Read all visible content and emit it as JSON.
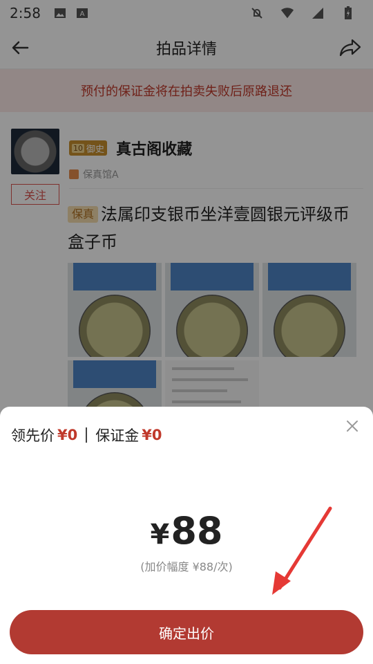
{
  "status_bar": {
    "time": "2:58"
  },
  "nav": {
    "title": "拍品详情"
  },
  "notice": {
    "text": "预付的保证金将在拍卖失败后原路退还"
  },
  "seller": {
    "level_num": "10",
    "level_label": "御史",
    "name": "真古阁收藏",
    "tag": "保真馆A",
    "follow_label": "关注"
  },
  "lot": {
    "tag": "保真",
    "title": "法属印支银币坐洋壹圆银元评级币盒子币"
  },
  "sheet": {
    "leading_label": "领先价",
    "leading_value": "¥0",
    "deposit_label": "保证金",
    "deposit_value": "¥0",
    "bid_yen": "¥",
    "bid_amount": "88",
    "increment": "(加价幅度 ¥88/次)",
    "confirm_label": "确定出价"
  },
  "colors": {
    "accent": "#b23a32",
    "price_red": "#c0392b",
    "annotation_arrow": "#e53935"
  }
}
